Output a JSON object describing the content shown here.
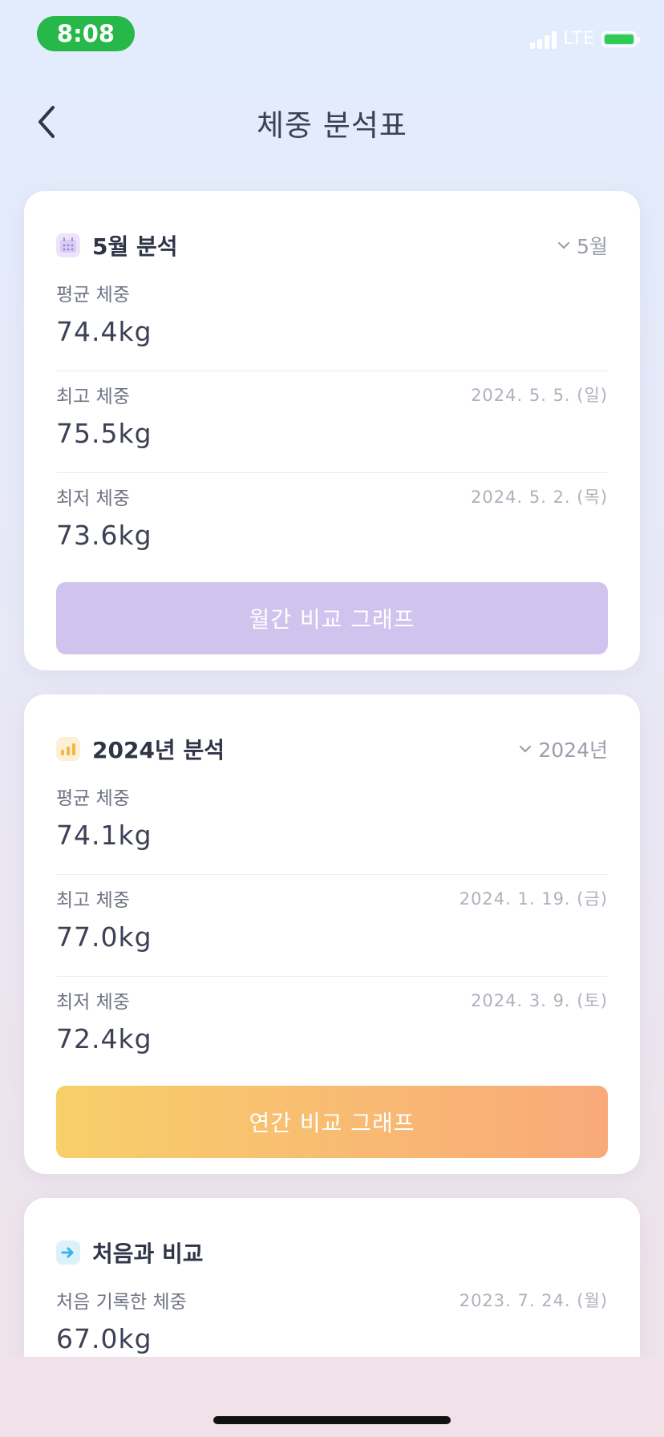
{
  "status_bar": {
    "time": "8:08",
    "network": "LTE"
  },
  "header": {
    "title": "체중 분석표"
  },
  "monthly": {
    "title": "5월 분석",
    "selector": "5월",
    "rows": [
      {
        "label": "평균 체중",
        "value": "74.4kg",
        "date": ""
      },
      {
        "label": "최고 체중",
        "value": "75.5kg",
        "date": "2024. 5. 5. (일)"
      },
      {
        "label": "최저 체중",
        "value": "73.6kg",
        "date": "2024. 5. 2. (목)"
      }
    ],
    "button": "월간 비교 그래프",
    "accent": "#d0c3ee"
  },
  "yearly": {
    "title": "2024년 분석",
    "selector": "2024년",
    "rows": [
      {
        "label": "평균 체중",
        "value": "74.1kg",
        "date": ""
      },
      {
        "label": "최고 체중",
        "value": "77.0kg",
        "date": "2024. 1. 19. (금)"
      },
      {
        "label": "최저 체중",
        "value": "72.4kg",
        "date": "2024. 3. 9. (토)"
      }
    ],
    "button": "연간 비교 그래프",
    "accent": "#f8cf69"
  },
  "compare": {
    "title": "처음과 비교",
    "rows": [
      {
        "label": "처음 기록한 체중",
        "value": "67.0kg",
        "date": "2023. 7. 24. (월)"
      }
    ]
  },
  "icons": {
    "back": "chevron-left-icon",
    "monthly": "calendar-icon",
    "yearly": "bar-chart-icon",
    "compare": "arrow-right-icon",
    "dropdown": "chevron-down-icon"
  }
}
